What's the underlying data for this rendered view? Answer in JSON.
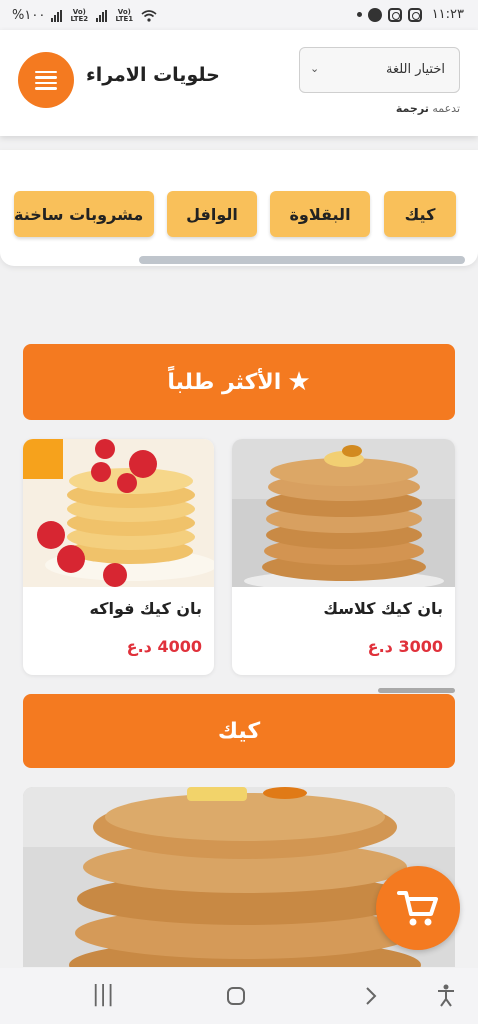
{
  "status_bar": {
    "time": "١١:٢٣",
    "battery": "%١٠٠",
    "sim1": "Vo) LTE2",
    "sim2": "Vo) LTE1"
  },
  "header": {
    "brand": "حلويات الامراء",
    "language_select": {
      "value": "اختيار اللغة"
    },
    "powered_by_prefix": "تدعمه",
    "powered_by_name": "ترجمة"
  },
  "categories": [
    {
      "label": "كيك"
    },
    {
      "label": "البقلاوة"
    },
    {
      "label": "الوافل"
    },
    {
      "label": "مشروبات ساخنة"
    }
  ],
  "sections": {
    "most_ordered": "الأكثر طلباً",
    "cake": "كيك"
  },
  "products": [
    {
      "name": "بان كيك كلاسك",
      "price": "3000 د.ع"
    },
    {
      "name": "بان كيك فواكه",
      "price": "4000 د.ع"
    }
  ],
  "icons": {
    "menu": "hamburger-icon",
    "star": "star-icon",
    "cart": "cart-icon"
  },
  "colors": {
    "accent": "#f47a20",
    "category": "#f9c05a",
    "price": "#e0313b"
  }
}
